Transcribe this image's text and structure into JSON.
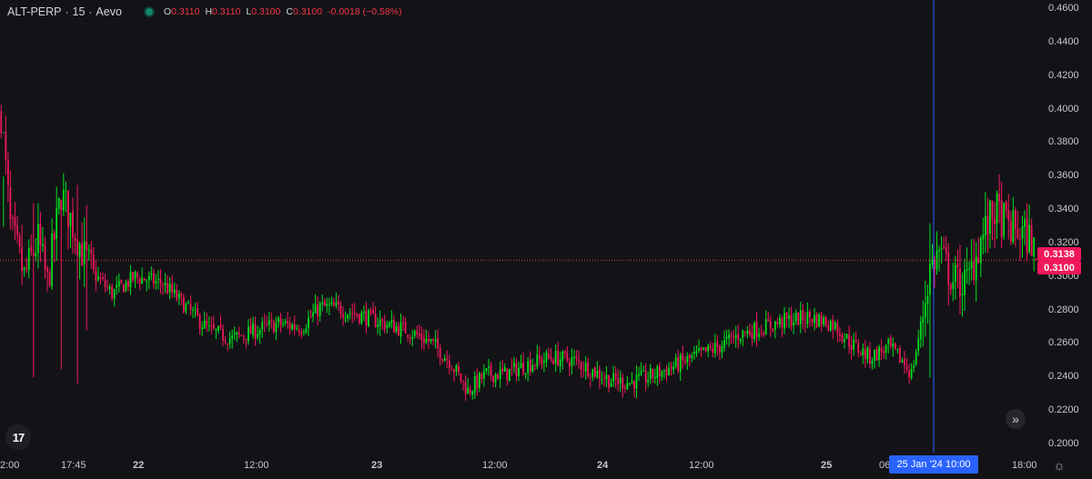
{
  "legend": {
    "symbol": "ALT-PERP",
    "interval": "15",
    "exchange": "Aevo",
    "sep": "·",
    "o_label": "O",
    "o_value": "0.3110",
    "h_label": "H",
    "h_value": "0.3110",
    "l_label": "L",
    "l_value": "0.3100",
    "c_label": "C",
    "c_value": "0.3100",
    "change": "-0.0018 (−0.58%)"
  },
  "colors": {
    "background": "#131317",
    "up": "#00e11e",
    "down": "#f0185a",
    "crosshair": "#2962ff",
    "price_line": "#f23645"
  },
  "price_tags": {
    "upper": "0.3138",
    "lower": "0.3100"
  },
  "crosshair_label": "25 Jan '24   10:00",
  "icons": {
    "logo": "tradingview-logo-icon",
    "scroll": "scroll-to-realtime-icon",
    "settings": "gear-icon"
  },
  "chart_data": {
    "type": "candlestick",
    "symbol": "ALT-PERP",
    "interval": "15",
    "ylim": [
      0.195,
      0.4655
    ],
    "y_ticks": [
      "0.2000",
      "0.2200",
      "0.2400",
      "0.2600",
      "0.2800",
      "0.3000",
      "0.3200",
      "0.3400",
      "0.3600",
      "0.3800",
      "0.4000",
      "0.4200",
      "0.4400",
      "0.4600"
    ],
    "y_tick_values": [
      0.2,
      0.22,
      0.24,
      0.26,
      0.28,
      0.3,
      0.32,
      0.34,
      0.36,
      0.38,
      0.4,
      0.42,
      0.44,
      0.46
    ],
    "x_ticks": [
      "2:00",
      "17:45",
      "22",
      "12:00",
      "23",
      "12:00",
      "24",
      "12:00",
      "25",
      "06",
      "18:00"
    ],
    "current_price": 0.31,
    "last_high_label": 0.3138,
    "crosshair_time": "25 Jan '24 10:00",
    "anchors": [
      [
        0,
        0.398
      ],
      [
        4,
        0.33
      ],
      [
        10,
        0.3
      ],
      [
        16,
        0.322
      ],
      [
        20,
        0.296
      ],
      [
        26,
        0.35
      ],
      [
        30,
        0.335
      ],
      [
        36,
        0.312
      ],
      [
        40,
        0.302
      ],
      [
        48,
        0.29
      ],
      [
        58,
        0.3
      ],
      [
        70,
        0.296
      ],
      [
        80,
        0.282
      ],
      [
        90,
        0.268
      ],
      [
        100,
        0.263
      ],
      [
        110,
        0.268
      ],
      [
        120,
        0.272
      ],
      [
        130,
        0.27
      ],
      [
        138,
        0.282
      ],
      [
        146,
        0.281
      ],
      [
        156,
        0.277
      ],
      [
        166,
        0.272
      ],
      [
        176,
        0.268
      ],
      [
        186,
        0.261
      ],
      [
        194,
        0.25
      ],
      [
        202,
        0.232
      ],
      [
        210,
        0.242
      ],
      [
        218,
        0.242
      ],
      [
        228,
        0.248
      ],
      [
        238,
        0.252
      ],
      [
        248,
        0.25
      ],
      [
        256,
        0.244
      ],
      [
        264,
        0.238
      ],
      [
        272,
        0.237
      ],
      [
        280,
        0.24
      ],
      [
        290,
        0.246
      ],
      [
        300,
        0.252
      ],
      [
        310,
        0.258
      ],
      [
        320,
        0.266
      ],
      [
        330,
        0.27
      ],
      [
        340,
        0.274
      ],
      [
        350,
        0.276
      ],
      [
        360,
        0.272
      ],
      [
        368,
        0.26
      ],
      [
        376,
        0.252
      ],
      [
        384,
        0.258
      ],
      [
        390,
        0.25
      ],
      [
        394,
        0.242
      ],
      [
        398,
        0.27
      ],
      [
        402,
        0.305
      ],
      [
        406,
        0.315
      ],
      [
        412,
        0.298
      ],
      [
        418,
        0.296
      ],
      [
        424,
        0.322
      ],
      [
        430,
        0.34
      ],
      [
        436,
        0.33
      ],
      [
        442,
        0.326
      ],
      [
        446,
        0.322
      ],
      [
        448,
        0.31
      ]
    ]
  }
}
